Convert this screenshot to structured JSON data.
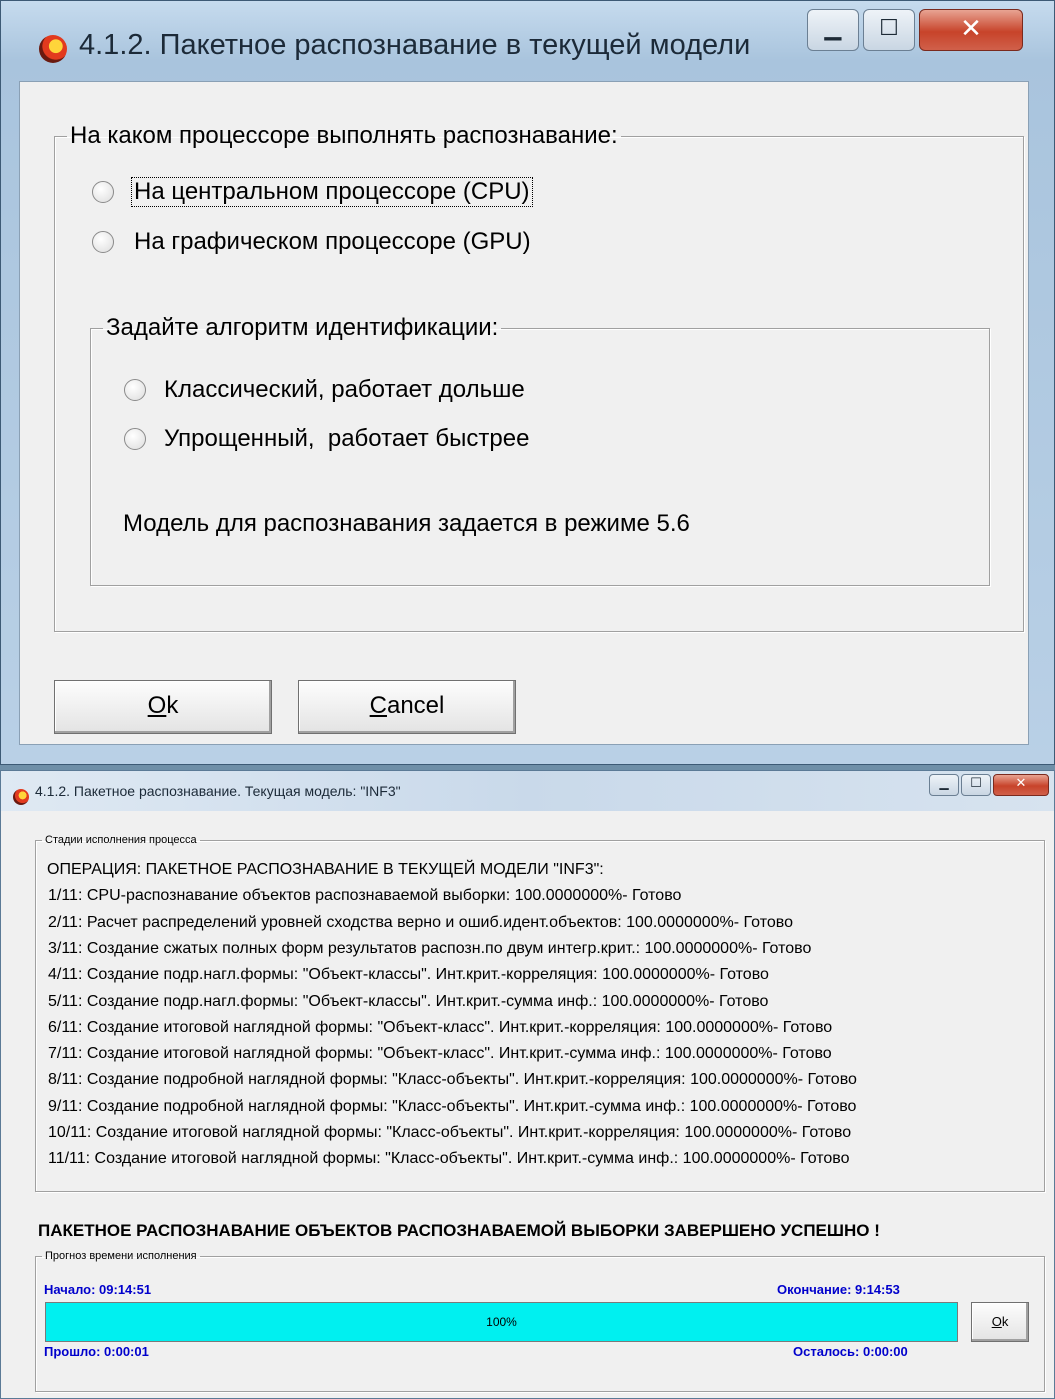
{
  "dialog": {
    "title": "4.1.2. Пакетное распознавание в текущей модели",
    "processor_group": {
      "label": "На каком процессоре выполнять распознавание:",
      "options": [
        {
          "label": "На центральном процессоре (CPU)",
          "selected": true
        },
        {
          "label": "На графическом процессоре (GPU)",
          "selected": false
        }
      ]
    },
    "algorithm_group": {
      "label": "Задайте алгоритм идентификации:",
      "options": [
        {
          "label": "Классический, работает дольше",
          "selected": false
        },
        {
          "label": "Упрощенный,  работает быстрее",
          "selected": true
        }
      ],
      "note": "Модель для распознавания задается в режиме 5.6"
    },
    "ok_button": {
      "prefix": "",
      "mnemonic": "O",
      "rest": "k"
    },
    "cancel_button": {
      "prefix": "",
      "mnemonic": "C",
      "rest": "ancel"
    }
  },
  "progress_window": {
    "title": "4.1.2. Пакетное распознавание. Текущая модель: \"INF3\"",
    "stages_label": "Стадии исполнения процесса",
    "log_lines": [
      "ОПЕРАЦИЯ: ПАКЕТНОЕ РАСПОЗНАВАНИЕ В ТЕКУЩЕЙ МОДЕЛИ \"INF3\":",
      "1/11: CPU-распознавание объектов распознаваемой выборки: 100.0000000%- Готово",
      "2/11: Расчет распределений уровней сходства верно и ошиб.идент.объектов: 100.0000000%- Готово",
      "3/11: Создание сжатых полных форм результатов распозн.по двум интегр.крит.: 100.0000000%- Готово",
      "4/11: Создание подр.нагл.формы: \"Объект-классы\". Инт.крит.-корреляция: 100.0000000%- Готово",
      "5/11: Создание подр.нагл.формы: \"Объект-классы\". Инт.крит.-сумма инф.: 100.0000000%- Готово",
      "6/11: Создание итоговой наглядной формы: \"Объект-класс\". Инт.крит.-корреляция: 100.0000000%- Готово",
      "7/11: Создание итоговой наглядной формы: \"Объект-класс\". Инт.крит.-сумма инф.: 100.0000000%- Готово",
      "8/11: Создание подробной наглядной формы: \"Класс-объекты\". Инт.крит.-корреляция: 100.0000000%- Готово",
      "9/11: Создание подробной наглядной формы: \"Класс-объекты\". Инт.крит.-сумма инф.: 100.0000000%- Готово",
      "10/11: Создание итоговой наглядной формы: \"Класс-объекты\". Инт.крит.-корреляция: 100.0000000%- Готово",
      "11/11: Создание итоговой наглядной формы: \"Класс-объекты\". Инт.крит.-сумма инф.: 100.0000000%- Готово"
    ],
    "success_message": "ПАКЕТНОЕ РАСПОЗНАВАНИЕ ОБЪЕКТОВ РАСПОЗНАВАЕМОЙ ВЫБОРКИ ЗАВЕРШЕНО УСПЕШНО !",
    "forecast_label": "Прогноз времени исполнения",
    "start": "Начало: 09:14:51",
    "end": "Окончание: 9:14:53",
    "elapsed": "Прошло: 0:00:01",
    "remaining": "Осталось: 0:00:00",
    "progress_percent": 100,
    "progress_text": "100%",
    "ok_button": {
      "mnemonic": "O",
      "rest": "k"
    }
  },
  "icons": {
    "app": "app-logo-icon",
    "minimize": "minimize-icon",
    "maximize": "maximize-icon",
    "close": "close-icon"
  },
  "colors": {
    "progress_fill": "#00f0f0",
    "time_text": "#0000cc"
  }
}
